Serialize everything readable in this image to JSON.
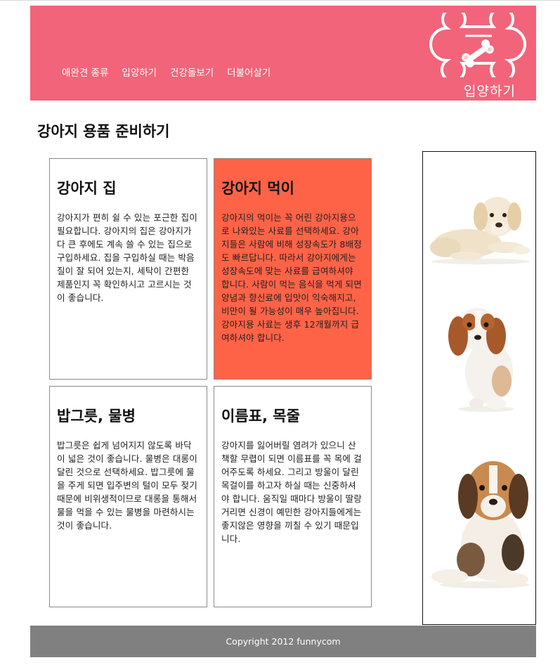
{
  "header": {
    "nav": [
      "애완견 종류",
      "입양하기",
      "건강돌보기",
      "더불어살기"
    ],
    "logo_text": "입양하기"
  },
  "main": {
    "title": "강아지 용품 준비하기",
    "cards": [
      {
        "title": "강아지 집",
        "body": "강아지가 편히 쉴 수 있는 포근한 집이 필요합니다. 강아지의 집은 강아지가 다 큰 후에도 계속 쓸 수 있는 집으로 구입하세요. 집을 구입하실 때는 박음질이 잘 되어 있는지, 세탁이 간편한 제품인지 꼭 확인하시고 고르시는 것이 좋습니다."
      },
      {
        "title": "강아지 먹이",
        "body": "강아지의 먹이는 꼭 어린 강아지용으로 나와있는 사료를 선택하세요. 강아지들은 사람에 비해 성장속도가 8배정도 빠르답니다. 따라서 강아지에게는 성장속도에 맞는 사료를 급여하셔야 합니다. 사람이 먹는 음식을 먹게 되면 양념과 향신료에 입맛이 익숙해지고, 비만이 될 가능성이 매우 높아집니다. 강아지용 사료는 생후 12개월까지 급여하셔야 합니다."
      },
      {
        "title": "밥그릇, 물병",
        "body": "밥그릇은 쉽게 넘어지지 않도록 바닥이 넓은 것이 좋습니다. 물병은 대롱이 달린 것으로 선택하세요. 밥그릇에 물을 주게 되면 입주변의 털이 모두 젖기 때문에 비위생적이므로 대롱을 통해서 물을 먹을 수 있는 물병을 마련하시는 것이 좋습니다."
      },
      {
        "title": "이름표, 목줄",
        "body": "강아지를 잃어버릴 염려가 있으니 산책할 무렵이 되면 이름표를 꼭 목에 걸어주도록 하세요. 그리고 방울이 달린 목걸이를 하고자 하실 때는 신중하셔야 합니다. 움직일 때마다 방울이 딸랑 거리면 신경이 예민한 강아지들에게는 좋지않은 영향을 끼칠 수 있기 때문입니다."
      }
    ]
  },
  "footer": {
    "copyright": "Copyright 2012 funnycom"
  },
  "colors": {
    "header_bg": "#f2647a",
    "highlight_card_bg": "#ff6347",
    "footer_bg": "#808080"
  }
}
